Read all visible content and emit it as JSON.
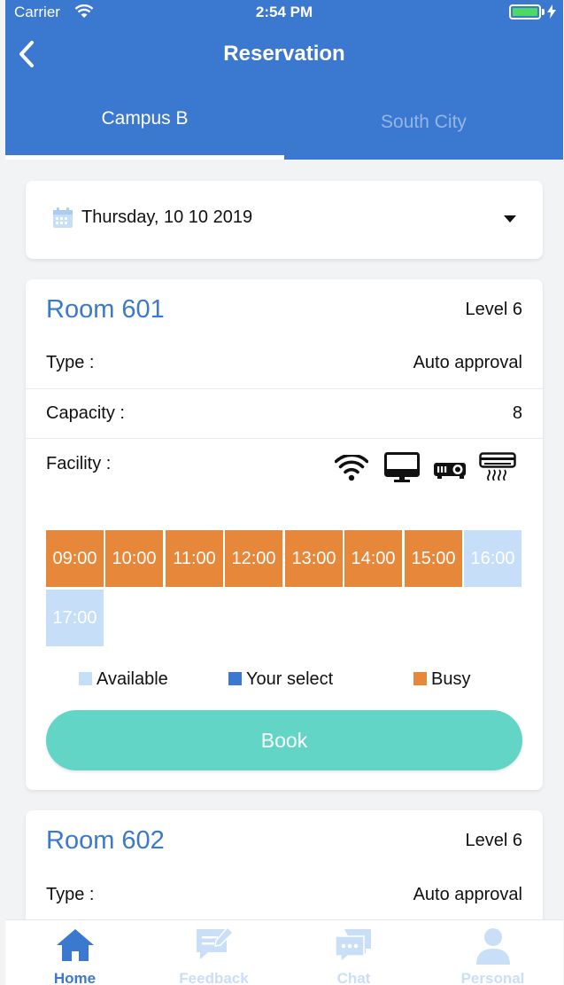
{
  "status_bar": {
    "carrier": "Carrier",
    "time": "2:54 PM"
  },
  "nav": {
    "title": "Reservation"
  },
  "tabs": [
    {
      "label": "Campus B",
      "active": true
    },
    {
      "label": "South City",
      "active": false
    }
  ],
  "date_picker": {
    "value": "Thursday, 10 10 2019"
  },
  "rooms": [
    {
      "name": "Room 601",
      "level": "Level 6",
      "type_label": "Type :",
      "type_value": "Auto approval",
      "capacity_label": "Capacity :",
      "capacity_value": "8",
      "facility_label": "Facility :",
      "facilities": [
        "wifi-icon",
        "monitor-icon",
        "projector-icon",
        "air-conditioner-icon"
      ],
      "slots": [
        {
          "time": "09:00",
          "state": "busy"
        },
        {
          "time": "10:00",
          "state": "busy"
        },
        {
          "time": "11:00",
          "state": "busy"
        },
        {
          "time": "12:00",
          "state": "busy"
        },
        {
          "time": "13:00",
          "state": "busy"
        },
        {
          "time": "14:00",
          "state": "busy"
        },
        {
          "time": "15:00",
          "state": "busy"
        },
        {
          "time": "16:00",
          "state": "available"
        },
        {
          "time": "17:00",
          "state": "available"
        }
      ],
      "book_label": "Book"
    },
    {
      "name": "Room 602",
      "level": "Level 6",
      "type_label": "Type :",
      "type_value": "Auto approval"
    }
  ],
  "legend": [
    {
      "label": "Available",
      "color": "#c6def7"
    },
    {
      "label": "Your select",
      "color": "#3b78d0"
    },
    {
      "label": "Busy",
      "color": "#e6873a"
    }
  ],
  "tabbar": [
    {
      "label": "Home",
      "icon": "home-icon",
      "active": true
    },
    {
      "label": "Feedback",
      "icon": "feedback-icon",
      "active": false
    },
    {
      "label": "Chat",
      "icon": "chat-icon",
      "active": false
    },
    {
      "label": "Personal",
      "icon": "person-icon",
      "active": false
    }
  ],
  "colors": {
    "primary": "#3b78d0",
    "busy": "#e6873a",
    "available": "#c6def7",
    "book_button": "#62d5c7"
  }
}
